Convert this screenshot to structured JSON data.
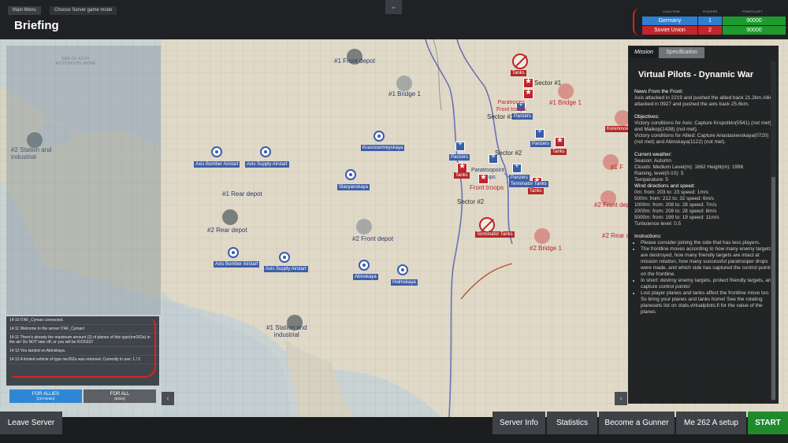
{
  "breadcrumb": {
    "main_menu": "Main Menu",
    "choose_server": "Choose Server game mode"
  },
  "title": "Briefing",
  "collapse_icon": "chevron-down-icon",
  "coalition_table": {
    "headers": [
      "COALITION",
      "PLAYERS",
      "POINTS LEFT"
    ],
    "rows": [
      {
        "coalition": "Germany",
        "players": "1",
        "points": "90000",
        "color": "#2f7fd0"
      },
      {
        "coalition": "Soviet Union",
        "players": "2",
        "points": "90000",
        "color": "#c3262b"
      }
    ],
    "points_color": "#1f9a2e"
  },
  "map": {
    "sea_label": "SEA OF AZOV\nAZOVSKOYE MORE",
    "labels": {
      "front_depot_1": "#1 Front depot",
      "bridge_1_blue": "#1 Bridge 1",
      "station_2": "#2 Station and\nindustrial",
      "rear_depot_1": "#1 Rear depot",
      "rear_depot_2": "#2 Rear depot",
      "front_depot_2": "#2 Front depot",
      "station_1": "#1 Station and\nindustrial",
      "sector_1_top": "Sector #1",
      "sector_1_left": "Sector #1",
      "sector_2_mid": "Sector #2",
      "sector_2_low": "Sector #2",
      "bridge_1_red": "#1 Bridge 1",
      "bridge_2_red": "#2 Bridge 1",
      "front_depot_red": "#2 Front depot",
      "rear_depot_red": "#2 Rear depot",
      "front_troops": "Front troops",
      "front_troops_top": "Paratroops\nFront troops",
      "paratroops_mid": "Paratroopoint\ntroops",
      "front_short": "#1 F"
    },
    "tags": {
      "axis_bomber_1": "Axis Bomber Airstart",
      "axis_supply_1": "Axis Supply Airstart",
      "axis_bomber_2": "Axis Bomber Airstart",
      "axis_supply_2": "Axis Supply Airstart",
      "krasnoarmeyskaya": "Krasnoarmeyskaya",
      "slavyanskaya": "Slavyanskaya",
      "abinskaya": "Abinskaya",
      "holmskaya": "Holmskaya",
      "korenovsk": "Korenovsk",
      "tanks_1": "Tanks",
      "tanks_2": "Tanks",
      "tanks_3": "Tanks",
      "tanks_4": "Tanks",
      "tanks_top": "Tanks",
      "panzers_1": "Panzers",
      "panzers_2": "Panzers",
      "panzers_3": "Panzers",
      "panzers_4": "Panzers",
      "terminator_tanks_1": "Terminator Tanks",
      "terminator_tanks_2": "Terminator Tanks",
      "terminator_tanks_3": "Terminator Tanks"
    }
  },
  "chat": {
    "messages": [
      "14:10 ITAF_Cymao connected.",
      "14:11 Welcome to the server ITAF_Cymao!",
      "14:11 There's already the maximum amount (2) of planes of this type(me262a) in the air! Do NOT take off, or you will be KICKED!",
      "14:12 You landed on Abinskaya.",
      "14:12 A limited vehicle of type me262a was returned. Currently in use: 1 / 2"
    ],
    "for_allies": "FOR ALLIES",
    "for_allies_hint": "[Ctrl+Enter]",
    "for_all": "FOR ALL",
    "for_all_hint": "[Enter]",
    "allies_color": "#2e86d4"
  },
  "panel": {
    "tabs": [
      "Mission",
      "Specification"
    ],
    "title": "Virtual Pilots - Dynamic War",
    "news_heading": "News From the Front:",
    "news_text": "Axis attacked in 2219 and pushed the allied back 21.2km.Allied attacked in 0927 and pushed the axis back 25.6km.",
    "objectives_heading": "Objectives:",
    "objectives_axis": "Victory conditions for Axis: Capture Kropotkin(0541) (not met) and Maikop(1438) (not met).",
    "objectives_allied": "Victory conditions for Allied: Capture Anastasievskaya(0720) (not met) and Abinskaya(1122) (not met).",
    "weather_heading": "Current weather:",
    "season": "Season: Autumn",
    "clouds": "Clouds: Medium Level(m): 1662 Height(m): 1996",
    "raining": "Raining, level(0-10): 5",
    "temperature": "Temperature: 5",
    "wind_heading": "Wind directions and speed:",
    "wind_0": "0m: from: 203 to: 23 speed: 1m/s",
    "wind_500": "500m: from: 212 to: 32 speed: 6m/s",
    "wind_1000": "1000m: from: 208 to: 28 speed: 7m/s",
    "wind_2000": "2000m: from: 208 to: 28 speed: 8m/s",
    "wind_5000": "5000m: from: 199 to: 19 speed: 11m/s",
    "turbulence": "Turbulence level: 0.5",
    "instructions_heading": "Instructions:",
    "instr_1": "Please consider joining the side that has less players.",
    "instr_2": "The frontline moves according to how many enemy targets are destroyed, how many friendly targets are intact at mission rotation, how many successful paratrooper drops were made, and which side has captured the control points on the frontline.",
    "instr_3": "In short: destroy enemy targets, protect friendly targets, and capture control points!",
    "instr_4": "Lost player planes and tanks affect the frontline move too. So bring your planes and tanks home! See the rotating planesets list on stats.virtualpilots.fi for the value of the planes"
  },
  "bottom": {
    "leave_server": "Leave Server",
    "server_info": "Server Info",
    "statistics": "Statistics",
    "become_gunner": "Become a Gunner",
    "setup": "Me 262 A setup",
    "start": "START",
    "start_color": "#1e8a2c"
  }
}
